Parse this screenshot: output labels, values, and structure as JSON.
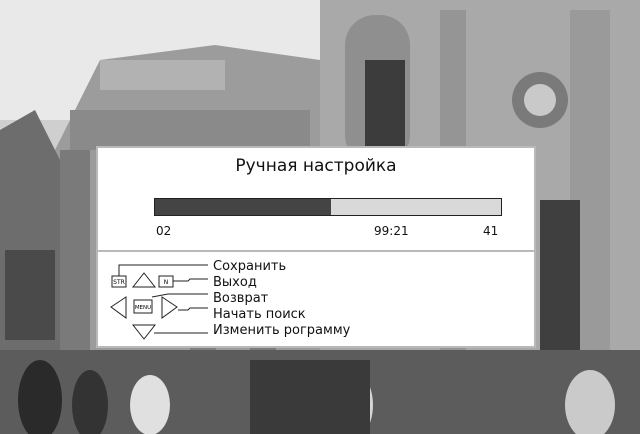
{
  "osd": {
    "title": "Ручная настройка",
    "progress": {
      "fill_percent": 51,
      "start": "02",
      "middle": "99:21",
      "end": "41"
    },
    "keys": {
      "str": "STR",
      "n": "N",
      "menu": "MENU"
    },
    "actions": [
      {
        "id": "save",
        "label": "Сохранить"
      },
      {
        "id": "exit",
        "label": "Выход"
      },
      {
        "id": "back",
        "label": "Возврат"
      },
      {
        "id": "search",
        "label": "Начать поиск"
      },
      {
        "id": "change",
        "label": "Изменить рограмму"
      }
    ]
  },
  "colors": {
    "panel": "#ffffff",
    "fill": "#444444",
    "track": "#d9d9d9",
    "border": "#b9b9b9"
  }
}
